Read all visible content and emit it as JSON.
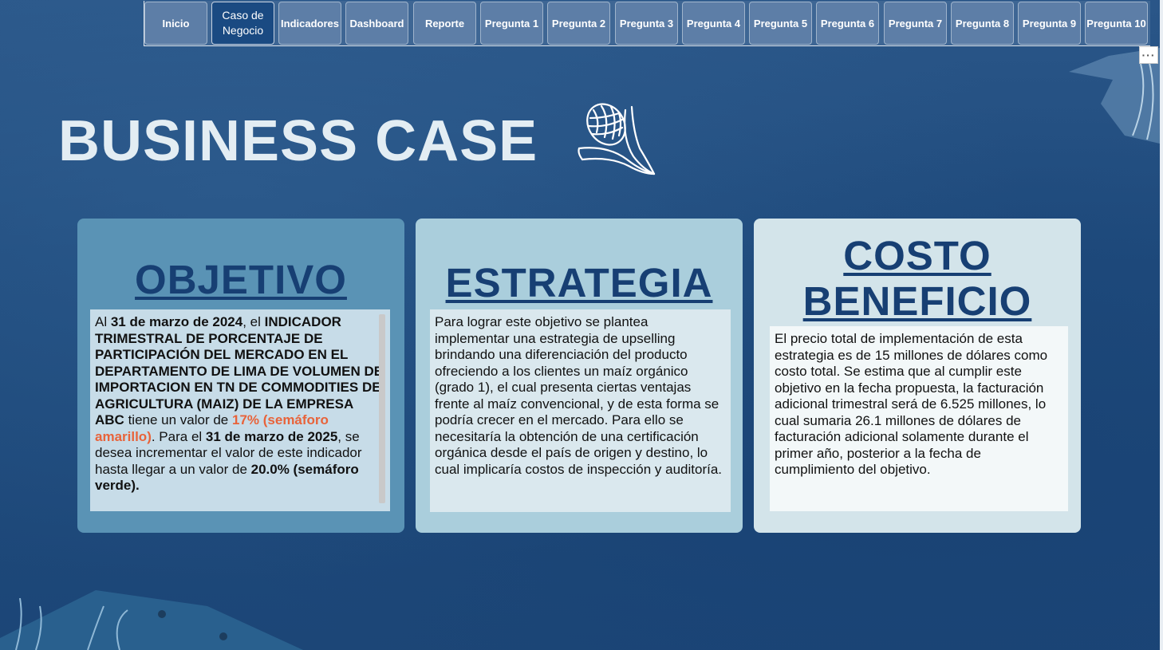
{
  "nav": {
    "items": [
      {
        "label": "Inicio",
        "active": false
      },
      {
        "label": "Caso de Negocio",
        "active": true
      },
      {
        "label": "Indicadores",
        "active": false
      },
      {
        "label": "Dashboard",
        "active": false
      },
      {
        "label": "Reporte",
        "active": false
      },
      {
        "label": "Pregunta 1",
        "active": false
      },
      {
        "label": "Pregunta 2",
        "active": false
      },
      {
        "label": "Pregunta 3",
        "active": false
      },
      {
        "label": "Pregunta 4",
        "active": false
      },
      {
        "label": "Pregunta 5",
        "active": false
      },
      {
        "label": "Pregunta 6",
        "active": false
      },
      {
        "label": "Pregunta 7",
        "active": false
      },
      {
        "label": "Pregunta 8",
        "active": false
      },
      {
        "label": "Pregunta 9",
        "active": false
      },
      {
        "label": "Pregunta 10",
        "active": false
      }
    ],
    "more_label": "···"
  },
  "page": {
    "title": "BUSINESS CASE",
    "icon": "corn-icon"
  },
  "cards": {
    "objetivo": {
      "heading": "OBJETIVO",
      "text": {
        "t1": "Al ",
        "t2": "31 de marzo de 2024",
        "t3": ", el ",
        "t4": "INDICADOR TRIMESTRAL DE PORCENTAJE DE PARTICIPACIÓN DEL MERCADO EN EL DEPARTAMENTO DE LIMA DE VOLUMEN DE IMPORTACION EN TN DE COMMODITIES DE AGRICULTURA (MAIZ) DE LA EMPRESA ABC",
        "t5": " tiene un valor de ",
        "t6": "17% (semáforo amarillo)",
        "t7": ". Para el ",
        "t8": "31 de marzo de 2025",
        "t9": ", se desea incrementar el valor de este indicador hasta llegar a un valor de ",
        "t10": "20.0% (semáforo verde)."
      }
    },
    "estrategia": {
      "heading": "ESTRATEGIA",
      "text": "Para lograr este objetivo se plantea implementar una estrategia de upselling brindando una diferenciación del producto ofreciendo a los clientes un maíz orgánico (grado 1), el cual presenta ciertas ventajas frente al maíz convencional, y de esta forma se podría crecer en el mercado. Para ello se necesitaría la obtención de una certificación orgánica desde el país de origen y destino, lo cual implicaría costos de inspección y auditoría."
    },
    "costo": {
      "heading_line1": "COSTO",
      "heading_line2": "BENEFICIO",
      "text": "El precio total de implementación de esta estrategia es de 15 millones de dólares como costo total. Se estima que al cumplir este objetivo en la fecha propuesta, la facturación adicional trimestral será de 6.525 millones, lo cual sumaria 26.1 millones de dólares de facturación adicional solamente durante el primer año, posterior a la fecha de cumplimiento del objetivo."
    }
  },
  "colors": {
    "background": "#1f4a7c",
    "nav_button": "#5d7ea7",
    "nav_active": "#1a4a82",
    "heading": "#173f73",
    "highlight_orange": "#e8633a",
    "card1": "#5a93b5",
    "card2": "#aacedc",
    "card3": "#d3e4ea"
  }
}
